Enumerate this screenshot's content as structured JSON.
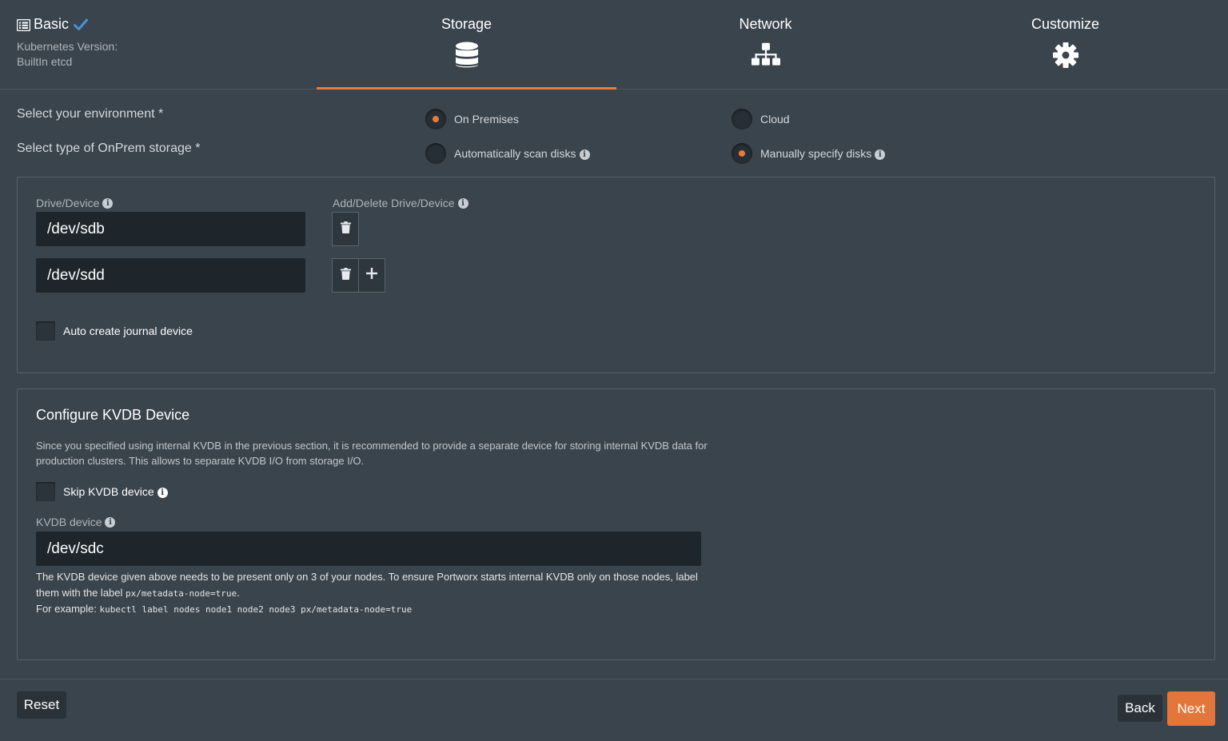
{
  "colors": {
    "accent": "#ea7a3b",
    "background": "#3a444c",
    "input_bg": "#1e262b",
    "check": "#4a90d9"
  },
  "header": {
    "basic": {
      "title": "Basic",
      "kubernetes_version_label": "Kubernetes Version:",
      "etcd_label": "BuiltIn etcd",
      "icon": "list-icon",
      "status_icon": "check-icon"
    },
    "steps": [
      {
        "label": "Storage",
        "icon": "database-icon",
        "active": true
      },
      {
        "label": "Network",
        "icon": "network-icon",
        "active": false
      },
      {
        "label": "Customize",
        "icon": "gear-icon",
        "active": false
      }
    ]
  },
  "environment": {
    "label": "Select your environment *",
    "options": [
      {
        "label": "On Premises",
        "selected": true
      },
      {
        "label": "Cloud",
        "selected": false
      }
    ]
  },
  "storage_type": {
    "label": "Select type of OnPrem storage *",
    "options": [
      {
        "label": "Automatically scan disks",
        "selected": false,
        "icon": "info-icon"
      },
      {
        "label": "Manually specify disks",
        "selected": true,
        "icon": "info-icon"
      }
    ]
  },
  "drives": {
    "drive_label": "Drive/Device",
    "add_delete_label": "Add/Delete Drive/Device",
    "devices": [
      "/dev/sdb",
      "/dev/sdd"
    ],
    "journal_checkbox_label": "Auto create journal device",
    "journal_checked": false
  },
  "kvdb": {
    "title": "Configure KVDB Device",
    "description": "Since you specified using internal KVDB in the previous section, it is recommended to provide a separate device for storing internal KVDB data for production clusters. This allows to separate KVDB I/O from storage I/O.",
    "skip_label": "Skip KVDB device",
    "skip_checked": false,
    "device_label": "KVDB device",
    "device_value": "/dev/sdc",
    "note_text": "The KVDB device given above needs to be present only on 3 of your nodes. To ensure Portworx starts internal KVDB only on those nodes, label them with the label",
    "note_label_code": "px/metadata-node=true",
    "note_period": ".",
    "example_prefix": "For example:",
    "example_code": "kubectl label nodes node1 node2 node3 px/metadata-node=true"
  },
  "footer": {
    "reset_label": "Reset",
    "back_label": "Back",
    "next_label": "Next"
  }
}
